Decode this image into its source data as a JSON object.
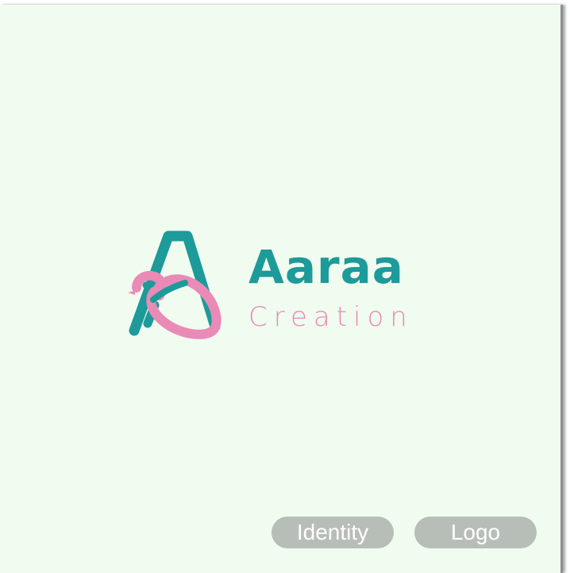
{
  "brand": {
    "name": "Aaraa",
    "tagline": "Creation"
  },
  "tags": {
    "identity": "Identity",
    "logo": "Logo"
  },
  "colors": {
    "background": "#effcef",
    "teal": "#1d9a9a",
    "pink": "#ea8ab7",
    "tag_background": "#b7beb7",
    "tag_text": "#ffffff"
  },
  "icons": {
    "brand_mark": "stylized-a-bird-icon"
  }
}
